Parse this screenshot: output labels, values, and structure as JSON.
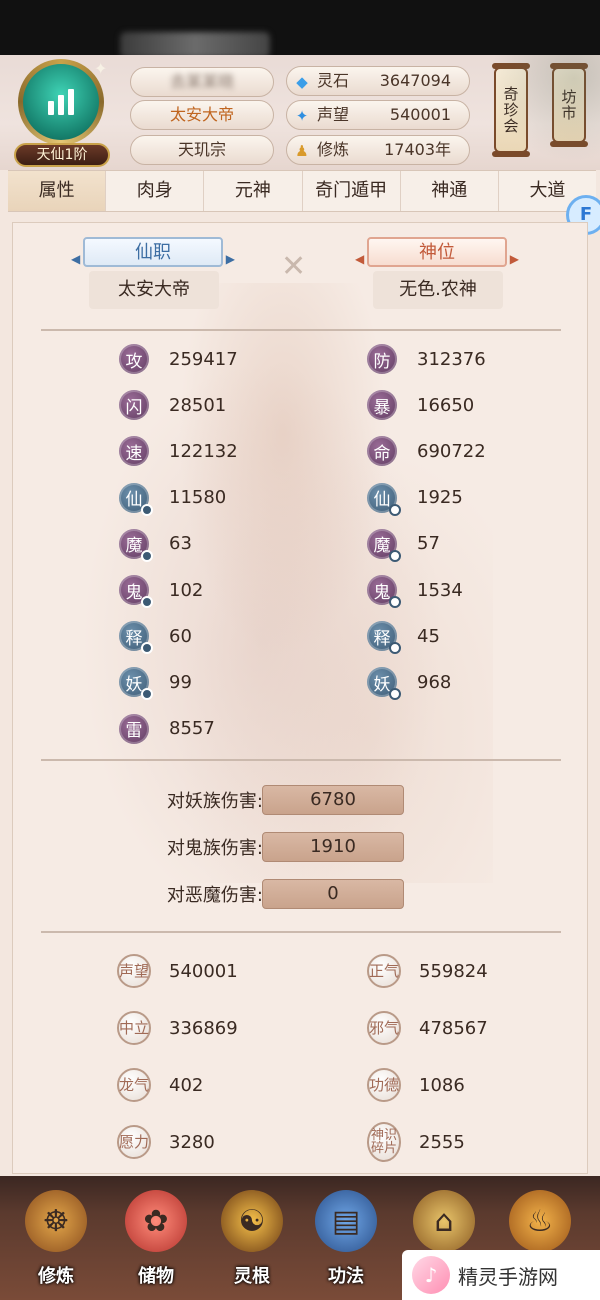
{
  "header": {
    "rank": "天仙1阶",
    "player_name": "去某某晓",
    "title": "太安大帝",
    "sect": "天玑宗",
    "resources": [
      {
        "icon": "spirit-stone-icon",
        "label": "灵石",
        "value": "3647094"
      },
      {
        "icon": "reputation-icon",
        "label": "声望",
        "value": "540001"
      },
      {
        "icon": "cultivation-icon",
        "label": "修炼",
        "value": "17403年"
      }
    ],
    "lantern_left": "奇珍会",
    "lantern_right": "坊市"
  },
  "tabs": [
    "属性",
    "肉身",
    "元神",
    "奇门遁甲",
    "神通",
    "大道"
  ],
  "posts": {
    "xianzhi_label": "仙职",
    "xianzhi_value": "太安大帝",
    "shenwei_label": "神位",
    "shenwei_value": "无色.农神"
  },
  "stats_left": [
    {
      "char": "攻",
      "value": "259417",
      "style": "purple",
      "mark": ""
    },
    {
      "char": "闪",
      "value": "28501",
      "style": "purple",
      "mark": ""
    },
    {
      "char": "速",
      "value": "122132",
      "style": "purple",
      "mark": ""
    },
    {
      "char": "仙",
      "value": "11580",
      "style": "blue",
      "mark": "bar"
    },
    {
      "char": "魔",
      "value": "63",
      "style": "purple",
      "mark": "bar"
    },
    {
      "char": "鬼",
      "value": "102",
      "style": "purple",
      "mark": "bar"
    },
    {
      "char": "释",
      "value": "60",
      "style": "blue",
      "mark": "bar"
    },
    {
      "char": "妖",
      "value": "99",
      "style": "blue",
      "mark": "bar"
    },
    {
      "char": "雷",
      "value": "8557",
      "style": "purple",
      "mark": ""
    }
  ],
  "stats_right": [
    {
      "char": "防",
      "value": "312376",
      "style": "purple",
      "mark": ""
    },
    {
      "char": "暴",
      "value": "16650",
      "style": "purple",
      "mark": ""
    },
    {
      "char": "命",
      "value": "690722",
      "style": "purple",
      "mark": ""
    },
    {
      "char": "仙",
      "value": "1925",
      "style": "blue",
      "mark": "dot"
    },
    {
      "char": "魔",
      "value": "57",
      "style": "purple",
      "mark": "dot"
    },
    {
      "char": "鬼",
      "value": "1534",
      "style": "purple",
      "mark": "dot"
    },
    {
      "char": "释",
      "value": "45",
      "style": "blue",
      "mark": "dot"
    },
    {
      "char": "妖",
      "value": "968",
      "style": "blue",
      "mark": "dot"
    }
  ],
  "damage": [
    {
      "label": "对妖族伤害:",
      "value": "6780"
    },
    {
      "label": "对鬼族伤害:",
      "value": "1910"
    },
    {
      "label": "对恶魔伤害:",
      "value": "0"
    }
  ],
  "misc_left": [
    {
      "seal": "声望",
      "value": "540001"
    },
    {
      "seal": "中立",
      "value": "336869"
    },
    {
      "seal": "龙气",
      "value": "402"
    },
    {
      "seal": "愿力",
      "value": "3280"
    }
  ],
  "misc_right": [
    {
      "seal": "正气",
      "value": "559824"
    },
    {
      "seal": "邪气",
      "value": "478567"
    },
    {
      "seal": "功德",
      "value": "1086"
    },
    {
      "seal": "神识碎片",
      "value": "2555"
    }
  ],
  "bottom_nav": [
    {
      "label": "修炼",
      "icon": "monk-icon"
    },
    {
      "label": "储物",
      "icon": "bag-icon"
    },
    {
      "label": "灵根",
      "icon": "spirit-root-icon"
    },
    {
      "label": "功法",
      "icon": "book-icon"
    },
    {
      "label": "",
      "icon": "pavilion-icon"
    },
    {
      "label": "",
      "icon": "gourd-icon"
    }
  ],
  "watermark": "精灵手游网",
  "colors": {
    "accent_title": "#c0651f",
    "badge_purple": "#5e3a5f",
    "badge_blue": "#3c5a74",
    "damage_box": "#c9a38c"
  }
}
